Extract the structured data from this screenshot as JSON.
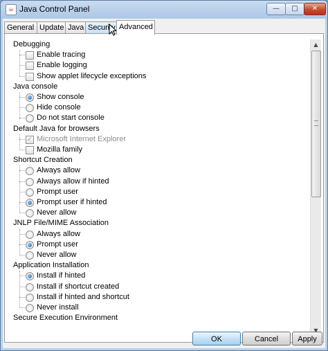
{
  "window": {
    "title": "Java Control Panel",
    "controls": {
      "minimize": "—",
      "maximize": "□",
      "close": "✕"
    }
  },
  "tabs": [
    {
      "label": "General"
    },
    {
      "label": "Update"
    },
    {
      "label": "Java"
    },
    {
      "label": "Security"
    },
    {
      "label": "Advanced",
      "active": true
    }
  ],
  "settings": [
    {
      "category": "Debugging",
      "items": [
        {
          "type": "checkbox",
          "label": "Enable tracing",
          "checked": false
        },
        {
          "type": "checkbox",
          "label": "Enable logging",
          "checked": false
        },
        {
          "type": "checkbox",
          "label": "Show applet lifecycle exceptions",
          "checked": false
        }
      ]
    },
    {
      "category": "Java console",
      "items": [
        {
          "type": "radio",
          "label": "Show console",
          "checked": true
        },
        {
          "type": "radio",
          "label": "Hide console",
          "checked": false
        },
        {
          "type": "radio",
          "label": "Do not start console",
          "checked": false
        }
      ]
    },
    {
      "category": "Default Java for browsers",
      "items": [
        {
          "type": "checkbox",
          "label": "Microsoft Internet Explorer",
          "checked": true,
          "disabled": true
        },
        {
          "type": "checkbox",
          "label": "Mozilla family",
          "checked": false
        }
      ]
    },
    {
      "category": "Shortcut Creation",
      "items": [
        {
          "type": "radio",
          "label": "Always allow",
          "checked": false
        },
        {
          "type": "radio",
          "label": "Always allow if hinted",
          "checked": false
        },
        {
          "type": "radio",
          "label": "Prompt user",
          "checked": false
        },
        {
          "type": "radio",
          "label": "Prompt user if hinted",
          "checked": true
        },
        {
          "type": "radio",
          "label": "Never allow",
          "checked": false
        }
      ]
    },
    {
      "category": "JNLP File/MIME Association",
      "items": [
        {
          "type": "radio",
          "label": "Always allow",
          "checked": false
        },
        {
          "type": "radio",
          "label": "Prompt user",
          "checked": true
        },
        {
          "type": "radio",
          "label": "Never allow",
          "checked": false
        }
      ]
    },
    {
      "category": "Application Installation",
      "items": [
        {
          "type": "radio",
          "label": "Install if hinted",
          "checked": true
        },
        {
          "type": "radio",
          "label": "Install if shortcut created",
          "checked": false
        },
        {
          "type": "radio",
          "label": "Install if hinted and shortcut",
          "checked": false
        },
        {
          "type": "radio",
          "label": "Never install",
          "checked": false
        }
      ]
    },
    {
      "category": "Secure Execution Environment",
      "items": []
    }
  ],
  "buttons": {
    "ok": "OK",
    "cancel": "Cancel",
    "apply": "Apply"
  }
}
